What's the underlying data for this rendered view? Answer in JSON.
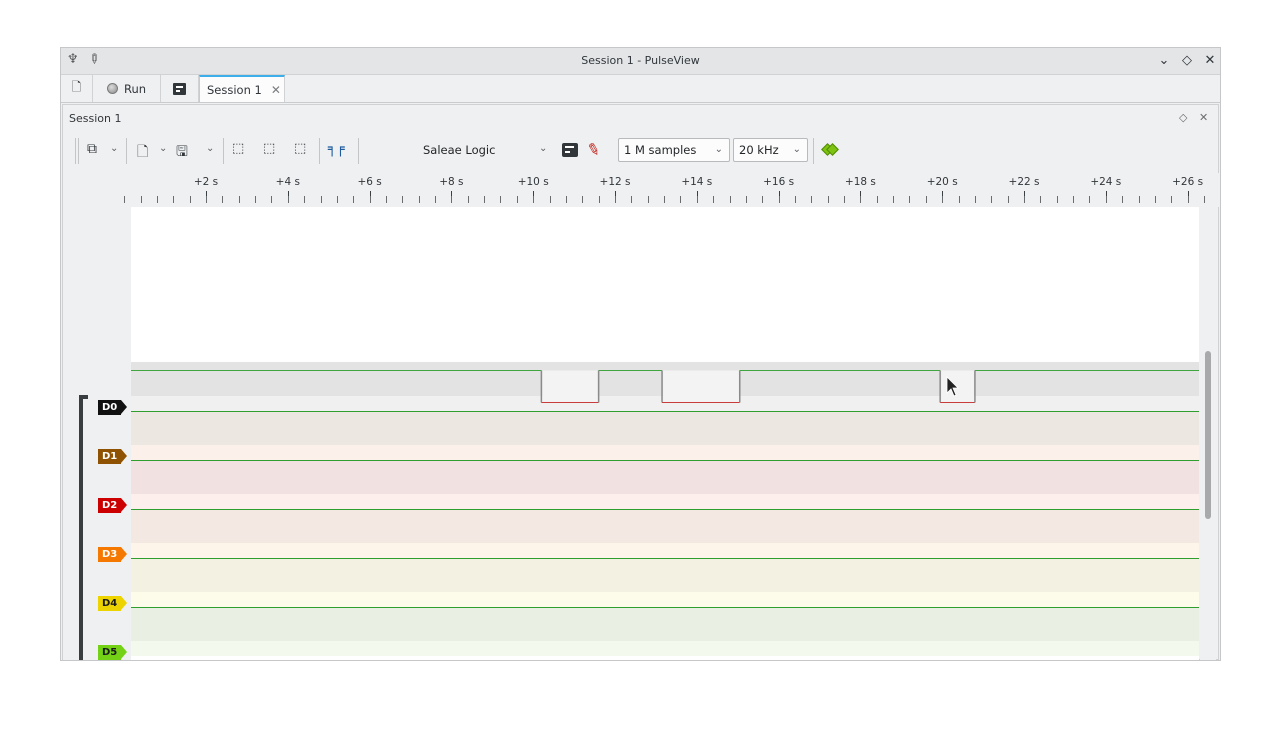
{
  "window": {
    "title": "Session 1 - PulseView",
    "controls": [
      "chevron-down-icon",
      "restore-icon",
      "close-icon"
    ]
  },
  "tabbar": {
    "run_label": "Run",
    "session_tab_label": "Session 1"
  },
  "panel": {
    "title": "Session 1"
  },
  "toolbar": {
    "device": "Saleae Logic",
    "samples": "1 M samples",
    "samplerate": "20 kHz"
  },
  "ruler": {
    "labels": [
      "+2 s",
      "+4 s",
      "+6 s",
      "+8 s",
      "+10 s",
      "+12 s",
      "+14 s",
      "+16 s",
      "+18 s",
      "+20 s",
      "+22 s",
      "+24 s",
      "+26 s"
    ]
  },
  "channels": [
    {
      "name": "D0",
      "color": "#111111"
    },
    {
      "name": "D1",
      "color": "#8f5202"
    },
    {
      "name": "D2",
      "color": "#cc0000"
    },
    {
      "name": "D3",
      "color": "#f57900"
    },
    {
      "name": "D4",
      "color": "#edd400"
    },
    {
      "name": "D5",
      "color": "#73d216"
    }
  ],
  "signal_d0": {
    "units": "s",
    "transitions": [
      {
        "t": 10.2,
        "level": "low"
      },
      {
        "t": 11.6,
        "level": "high"
      },
      {
        "t": 13.15,
        "level": "low"
      },
      {
        "t": 15.05,
        "level": "high"
      },
      {
        "t": 19.95,
        "level": "low"
      },
      {
        "t": 20.8,
        "level": "high"
      }
    ]
  }
}
